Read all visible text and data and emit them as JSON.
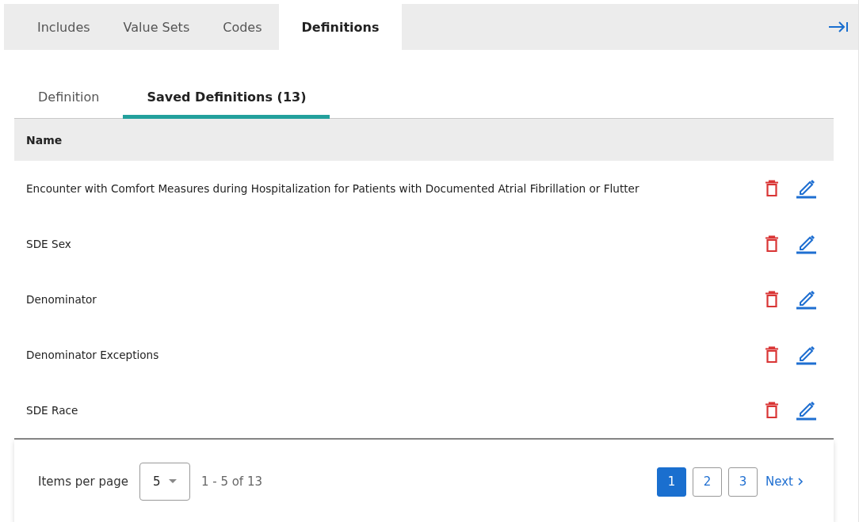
{
  "tabs": [
    {
      "label": "Includes",
      "selected": false
    },
    {
      "label": "Value Sets",
      "selected": false
    },
    {
      "label": "Codes",
      "selected": false
    },
    {
      "label": "Definitions",
      "selected": true
    }
  ],
  "subtabs": [
    {
      "label": "Definition",
      "selected": false
    },
    {
      "label": "Saved Definitions (13)",
      "selected": true
    }
  ],
  "table": {
    "columns": [
      "Name"
    ],
    "rows": [
      {
        "name": "Encounter with Comfort Measures during Hospitalization for Patients with Documented Atrial Fibrillation or Flutter"
      },
      {
        "name": "SDE Sex"
      },
      {
        "name": "Denominator"
      },
      {
        "name": "Denominator Exceptions"
      },
      {
        "name": "SDE Race"
      }
    ]
  },
  "pagination": {
    "items_label": "Items per page",
    "page_size": "5",
    "range": "1 - 5 of 13",
    "pages": [
      {
        "label": "1",
        "selected": true
      },
      {
        "label": "2",
        "selected": false
      },
      {
        "label": "3",
        "selected": false
      }
    ],
    "next": "Next"
  }
}
